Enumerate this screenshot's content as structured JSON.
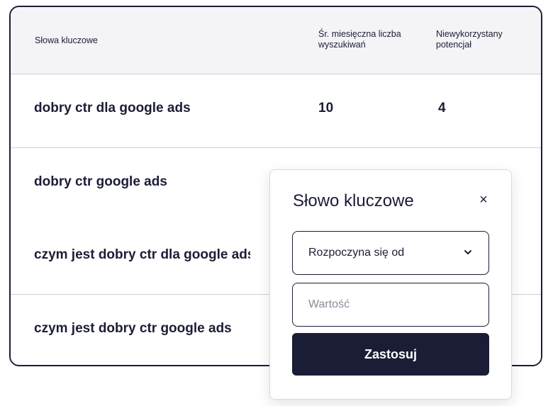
{
  "table": {
    "headers": {
      "keyword": "Słowa kluczowe",
      "volume": "Śr. miesięczna liczba wyszukiwań",
      "potential": "Niewykorzystany potencjał"
    },
    "rows": [
      {
        "keyword": "dobry ctr dla google ads",
        "volume": "10",
        "potential": "4"
      },
      {
        "keyword": "dobry ctr google ads",
        "volume": "",
        "potential": ""
      },
      {
        "keyword": "czym jest dobry ctr dla google ads",
        "volume": "",
        "potential": ""
      },
      {
        "keyword": "czym jest dobry ctr google ads",
        "volume": "",
        "potential": ""
      }
    ]
  },
  "filter": {
    "title": "Słowo kluczowe",
    "close_label": "×",
    "operator_value": "Rozpoczyna się od",
    "value_placeholder": "Wartość",
    "value": "",
    "apply_label": "Zastosuj"
  },
  "colors": {
    "primary": "#1b1d36",
    "header_bg": "#f4f4f6",
    "border": "#cfd0d6"
  }
}
